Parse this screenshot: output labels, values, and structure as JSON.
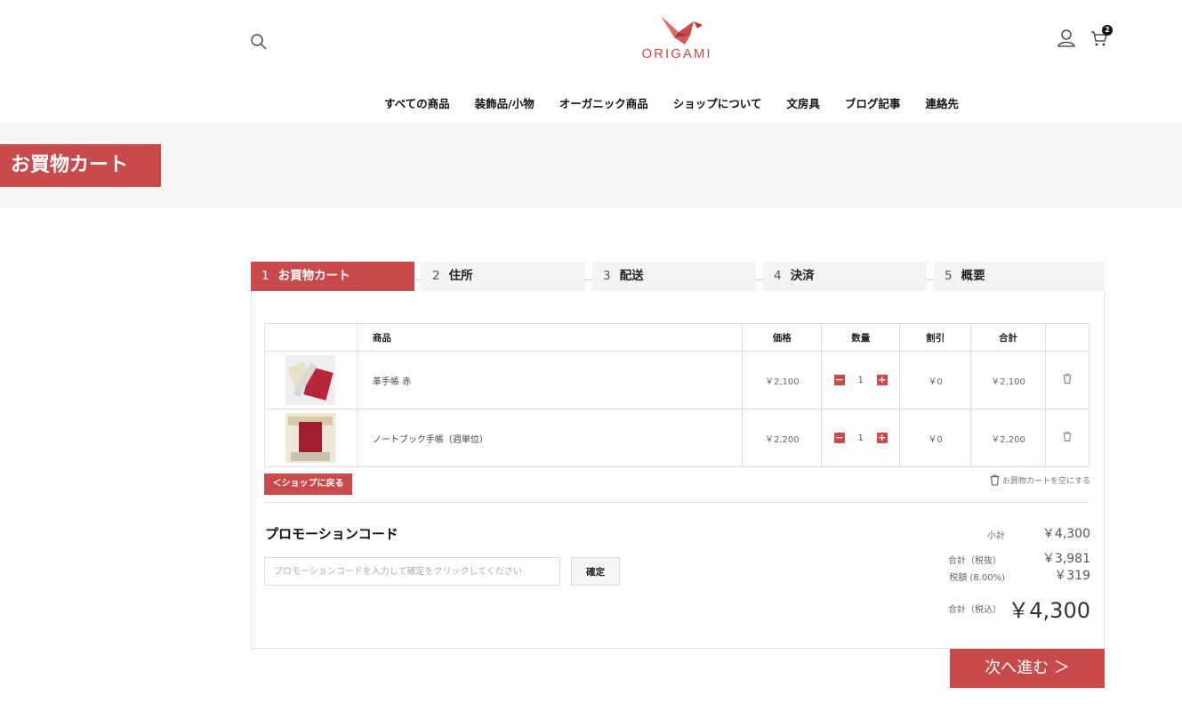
{
  "header": {
    "logo_text": "ORIGAMI",
    "cart_count": "2"
  },
  "nav": {
    "items": [
      "すべての商品",
      "装飾品/小物",
      "オーガニック商品",
      "ショップについて",
      "文房具",
      "ブログ記事",
      "連絡先"
    ]
  },
  "page_title": "お買物カート",
  "steps": [
    {
      "num": "1",
      "label": "お買物カート"
    },
    {
      "num": "2",
      "label": "住所"
    },
    {
      "num": "3",
      "label": "配送"
    },
    {
      "num": "4",
      "label": "決済"
    },
    {
      "num": "5",
      "label": "概要"
    }
  ],
  "table": {
    "headers": {
      "product": "商品",
      "price": "価格",
      "qty": "数量",
      "discount": "割引",
      "total": "合計"
    },
    "rows": [
      {
        "name": "革手帳 赤",
        "price": "￥2,100",
        "qty": "1",
        "discount": "￥0",
        "total": "￥2,100"
      },
      {
        "name": "ノートブック手帳（週単位）",
        "price": "￥2,200",
        "qty": "1",
        "discount": "￥0",
        "total": "￥2,200"
      }
    ]
  },
  "actions": {
    "back_label": "＜ショップに戻る",
    "empty_cart_label": "お買物カートを空にする",
    "next_label": "次へ進む ＞"
  },
  "promo": {
    "title": "プロモーションコード",
    "placeholder": "プロモーションコードを入力して確定をクリックしてください",
    "confirm_label": "確定"
  },
  "summary": {
    "subtotal_label": "小計",
    "subtotal": "￥4,300",
    "net_label": "合計（税抜）",
    "net": "￥3,981",
    "tax_label": "税額 (8.00%)",
    "tax": "￥319",
    "grand_label": "合計（税込）",
    "grand": "￥4,300"
  },
  "colors": {
    "accent": "#c94a4a",
    "band": "#f6f6f6"
  }
}
